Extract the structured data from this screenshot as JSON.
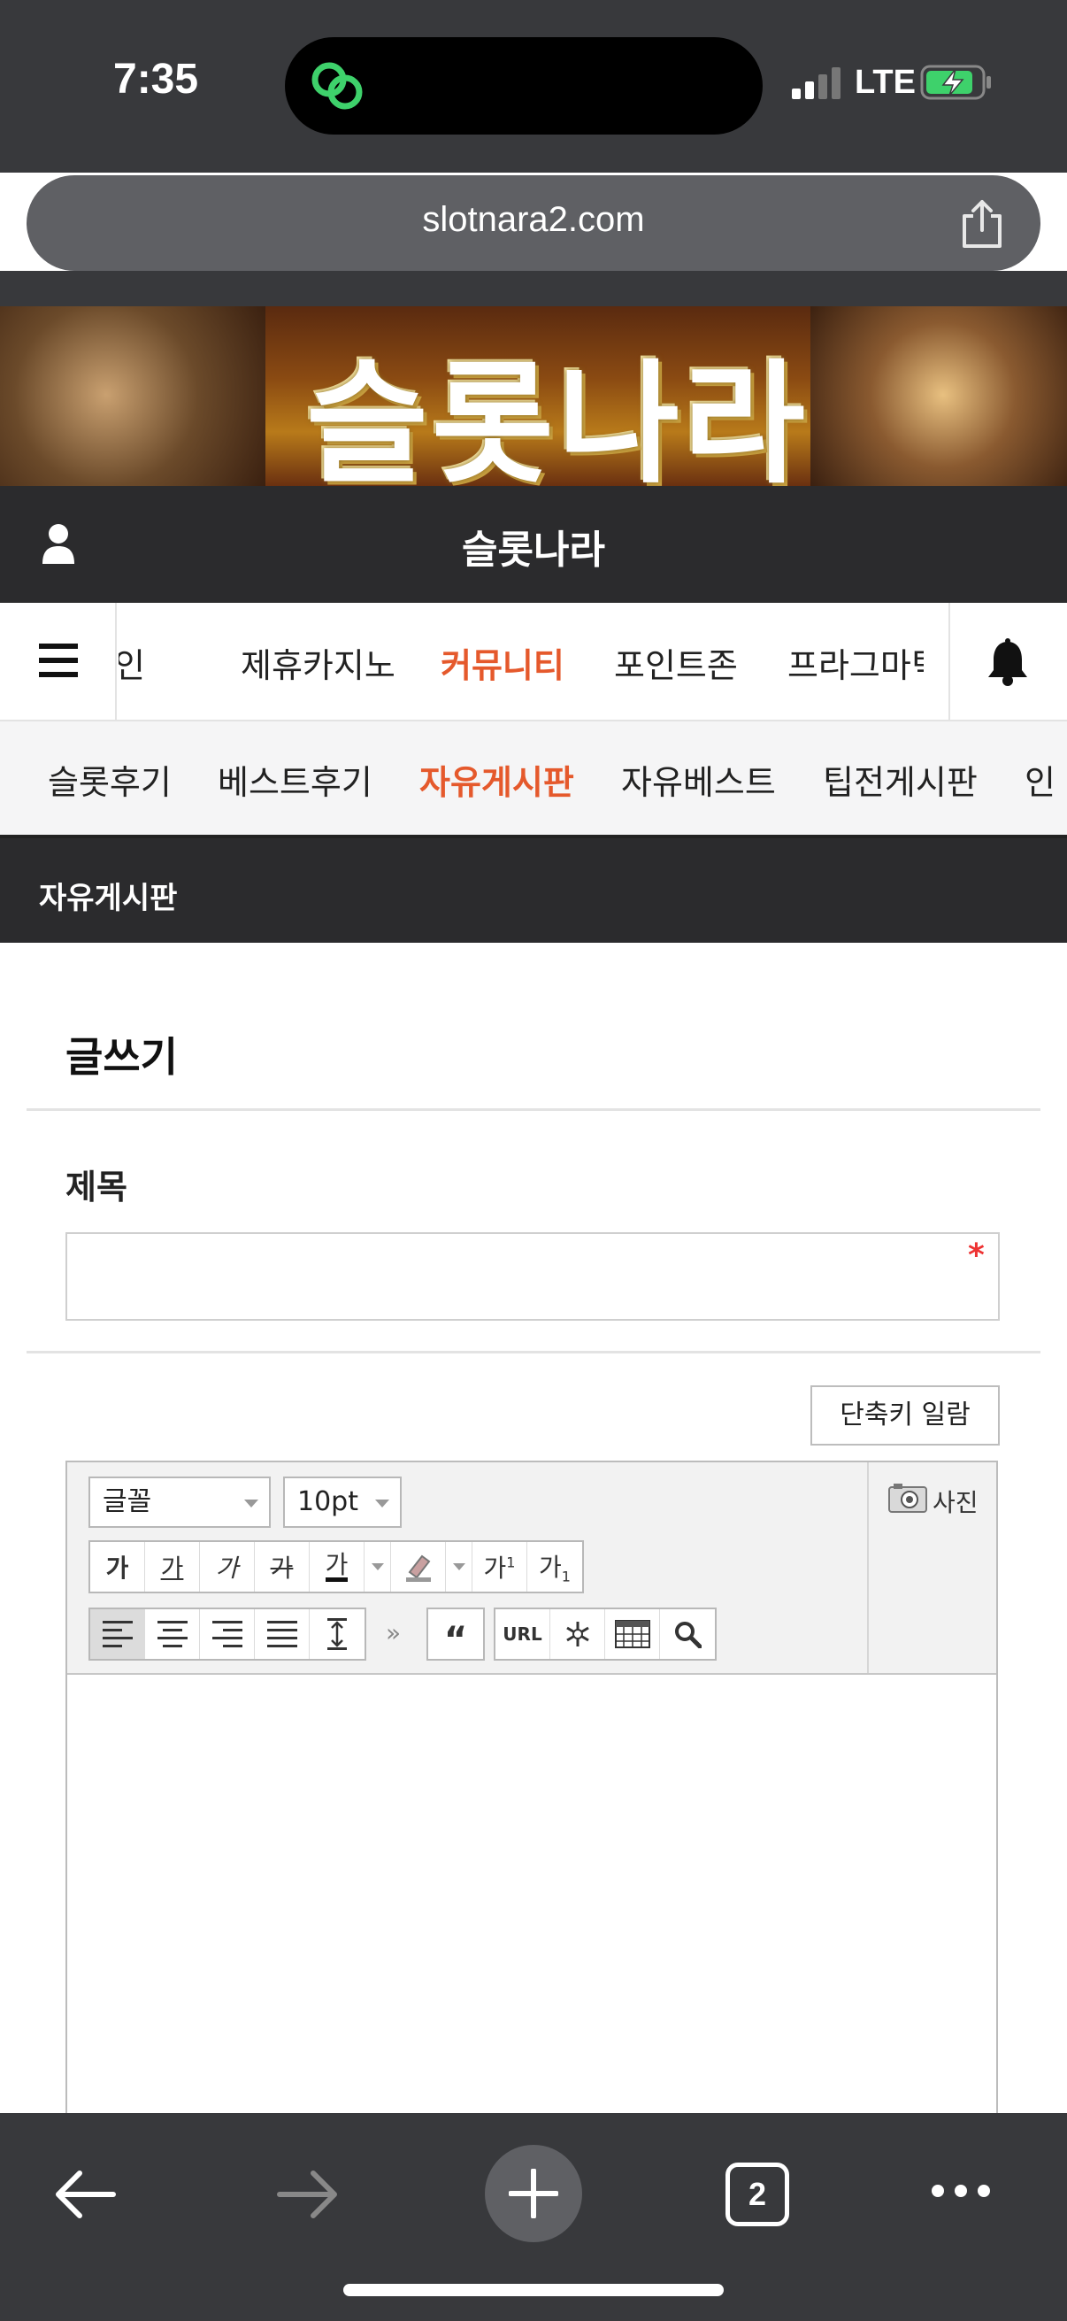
{
  "status_bar": {
    "time": "7:35",
    "network": "LTE"
  },
  "browser": {
    "url": "slotnara2.com",
    "tab_count": "2"
  },
  "banner": {
    "title": "슬롯나라"
  },
  "site": {
    "title": "슬롯나라"
  },
  "main_nav": {
    "items": [
      {
        "label": "메인"
      },
      {
        "label": "제휴카지노"
      },
      {
        "label": "커뮤니티",
        "active": true
      },
      {
        "label": "포인트존"
      },
      {
        "label": "프라그마틱"
      }
    ]
  },
  "sub_nav": {
    "items": [
      {
        "label": "슬롯후기"
      },
      {
        "label": "베스트후기"
      },
      {
        "label": "자유게시판",
        "active": true
      },
      {
        "label": "자유베스트"
      },
      {
        "label": "팁전게시판"
      },
      {
        "label": "인"
      }
    ]
  },
  "board": {
    "title": "자유게시판"
  },
  "form": {
    "heading": "글쓰기",
    "subject_label": "제목",
    "subject_value": "",
    "required_mark": "*",
    "shortcut_button": "단축키 일람"
  },
  "editor": {
    "font_select": "글꼴",
    "size_select": "10pt",
    "photo_label": "사진",
    "format_buttons": [
      "가",
      "가",
      "가",
      "가",
      "가"
    ],
    "superscript": "가",
    "subscript": "가",
    "url_button": "URL",
    "quote_button": "“",
    "more_button": "»",
    "body_value": ""
  },
  "colors": {
    "accent": "#e5592c",
    "header_bg": "#2b2b2d",
    "chrome_bg": "#38393c"
  }
}
